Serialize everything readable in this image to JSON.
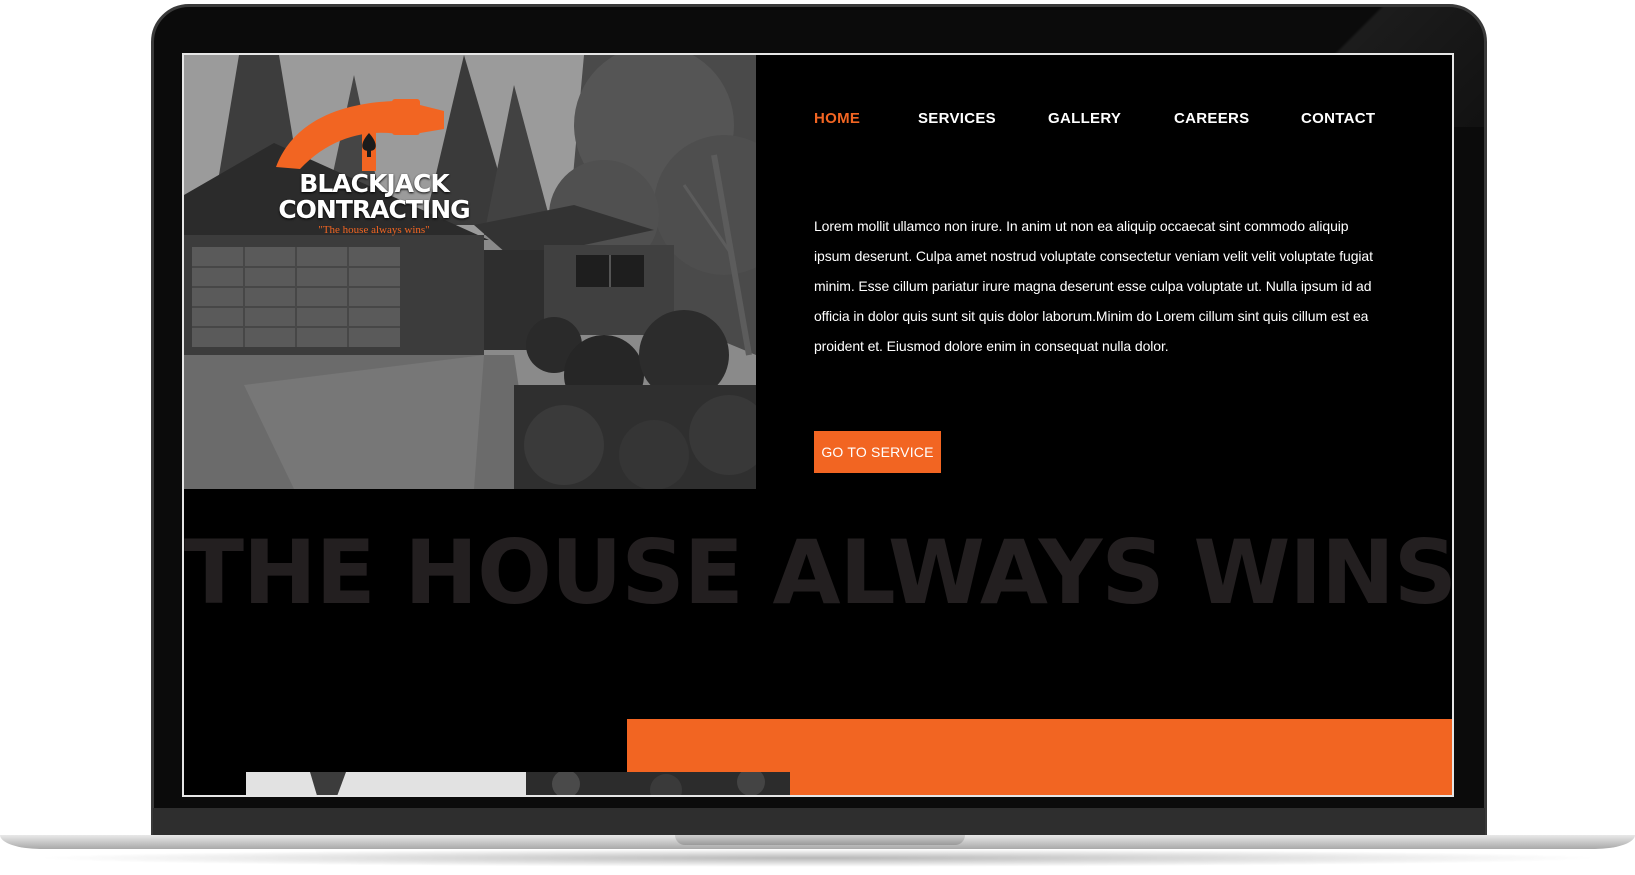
{
  "brand": {
    "name_line1": "BLACKJACK",
    "name_line2": "CONTRACTING",
    "tagline": "\"The house always wins\"",
    "accent_color": "#f26522"
  },
  "nav": {
    "items": [
      {
        "label": "HOME",
        "active": true
      },
      {
        "label": "SERVICES",
        "active": false
      },
      {
        "label": "GALLERY",
        "active": false
      },
      {
        "label": "CAREERS",
        "active": false
      },
      {
        "label": "CONTACT",
        "active": false
      }
    ]
  },
  "hero": {
    "image_icon": "house-photo",
    "text": "Lorem mollit ullamco non irure. In anim ut non ea aliquip occaecat sint commodo aliquip ipsum deserunt. Culpa amet nostrud voluptate consectetur veniam velit velit voluptate fugiat minim. Esse cillum pariatur irure magna deserunt esse culpa voluptate ut. Nulla ipsum id ad officia in dolor quis sunt sit quis dolor laborum.Minim do Lorem cillum sint quis cillum est ea proident et. Eiusmod dolore enim in consequat nulla dolor.",
    "cta_label": "GO TO SERVICE"
  },
  "watermark": {
    "text": "THE HOUSE ALWAYS WINS"
  }
}
